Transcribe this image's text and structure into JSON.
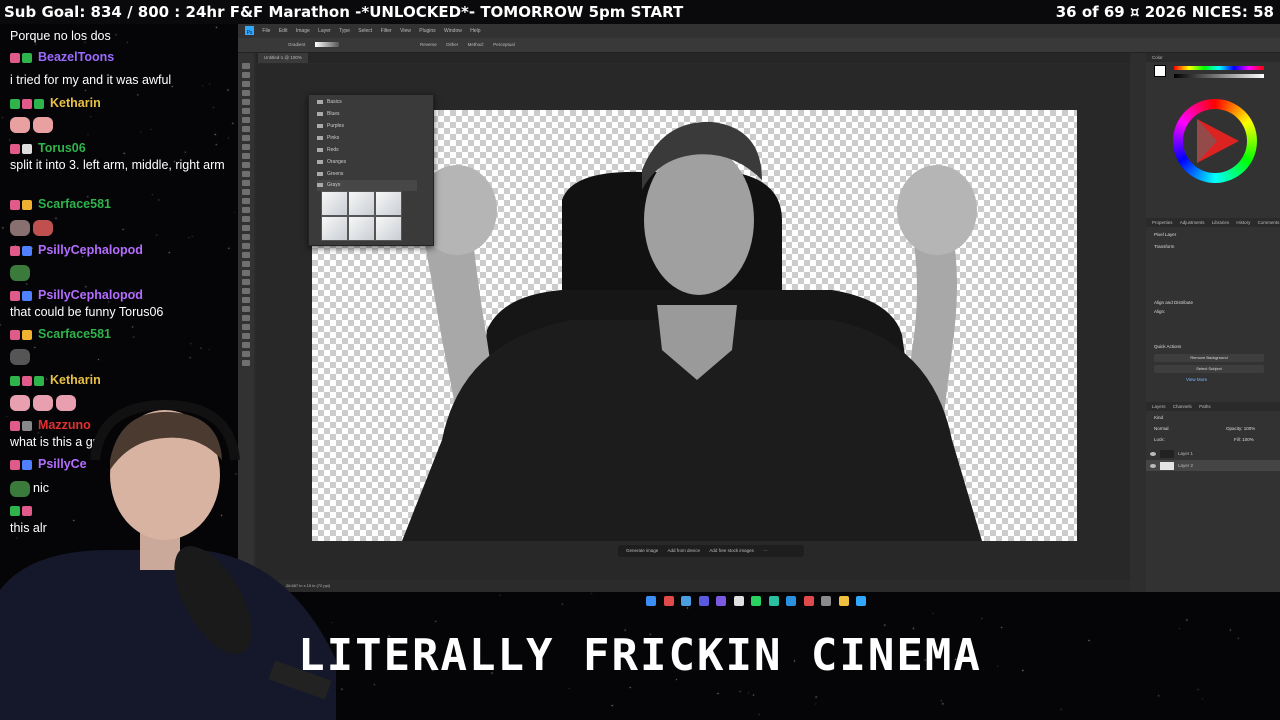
{
  "ticker": {
    "left": "Sub Goal: 834 / 800 : 24hr F&F Marathon -*UNLOCKED*- TOMORROW 5pm START",
    "right": "36 of 69  ¤  2026 NICES: 58"
  },
  "chat": [
    {
      "user": "",
      "text": "Porque no los dos",
      "color": "#ffffff"
    },
    {
      "user": "BeazelToons",
      "text": "",
      "color": "#9b6bff"
    },
    {
      "user": "",
      "text": "i tried for my  and it was awful",
      "color": "#ffffff"
    },
    {
      "user": "Ketharin",
      "text": "",
      "color": "#e8c046"
    },
    {
      "user": "Torus06",
      "text": "split it into 3. left arm, middle, right arm",
      "color": "#2fb34b"
    },
    {
      "user": "Scarface581",
      "text": "",
      "color": "#2fb34b"
    },
    {
      "user": "PsillyCephalopod",
      "text": "",
      "color": "#b46dff"
    },
    {
      "user": "PsillyCephalopod",
      "text": "that could be funny Torus06",
      "color": "#b46dff"
    },
    {
      "user": "Scarface581",
      "text": "",
      "color": "#2fb34b"
    },
    {
      "user": "Ketharin",
      "text": "",
      "color": "#e8c046"
    },
    {
      "user": "Mazzuno",
      "text": "what is this a gri",
      "color": "#e03030"
    },
    {
      "user": "PsillyCe",
      "text": "nic",
      "color": "#b46dff"
    },
    {
      "user": "",
      "text": "this alr",
      "color": "#ffffff"
    }
  ],
  "photoshop": {
    "menu": [
      "File",
      "Edit",
      "Image",
      "Layer",
      "Type",
      "Select",
      "Filter",
      "View",
      "Plugins",
      "Window",
      "Help"
    ],
    "options": [
      "Gradient",
      "Reverse",
      "Dither",
      "Method:",
      "Perceptual"
    ],
    "tab": "Untitled-1 @ 100%",
    "gradient_folders": [
      "Basics",
      "Blues",
      "Purples",
      "Pinks",
      "Reds",
      "Oranges",
      "Greens",
      "Grays"
    ],
    "context_bar": [
      "Generate image",
      "Add from device",
      "Add free stock images"
    ],
    "status": "26.667 in x 15 in (72 ppi)",
    "panels": {
      "color_tab": "Color",
      "properties_tabs": [
        "Properties",
        "Adjustments",
        "Libraries",
        "History",
        "Comments"
      ],
      "pixel_layer": "Pixel Layer",
      "transform": "Transform",
      "align": "Align and Distribute",
      "align_sub": "Align:",
      "quick_actions": "Quick Actions",
      "remove_bg": "Remove Background",
      "select_subject": "Select Subject",
      "view_more": "View More",
      "layers_tabs": [
        "Layers",
        "Channels",
        "Paths"
      ],
      "kind": "Kind",
      "blend": "Normal",
      "opacity": "Opacity: 100%",
      "lock": "Lock:",
      "fill": "Fill: 100%",
      "layers": [
        "Layer 1",
        "Layer 2"
      ]
    }
  },
  "caption": "LITERALLY FRICKIN CINEMA",
  "colors": {
    "ps_accent": "#31a8ff",
    "bg": "#050508"
  }
}
